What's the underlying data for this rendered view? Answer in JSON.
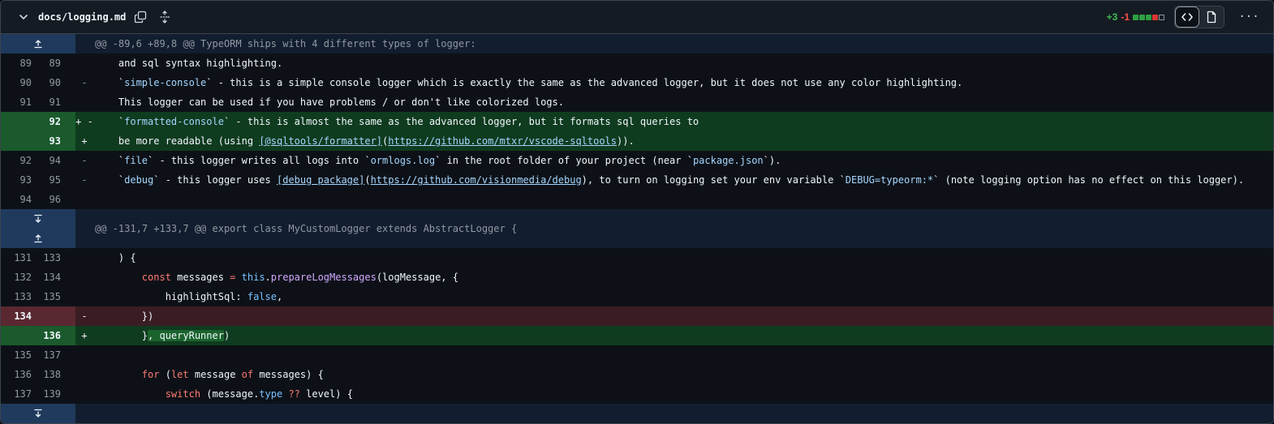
{
  "file": {
    "name": "docs/logging.md",
    "additions": "+3",
    "deletions": "-1",
    "blocks": [
      "g",
      "g",
      "g",
      "r",
      "n"
    ],
    "more": "···"
  },
  "hunks": [
    {
      "header": "@@ -89,6 +89,8 @@ TypeORM ships with 4 different types of logger:",
      "lines": [
        {
          "t": "ctx",
          "o": "89",
          "n": "89",
          "m": "",
          "c": "    and sql syntax highlighting."
        },
        {
          "t": "ctx",
          "o": "90",
          "n": "90",
          "m": "-",
          "c": "    `simple-console` - this is a simple console logger which is exactly the same as the advanced logger, but it does not use any color highlighting."
        },
        {
          "t": "ctx",
          "o": "91",
          "n": "91",
          "m": "",
          "c": "    This logger can be used if you have problems / or don't like colorized logs."
        },
        {
          "t": "add",
          "o": "",
          "n": "92",
          "m": "+ -",
          "c": "    `formatted-console` - this is almost the same as the advanced logger, but it formats sql queries to"
        },
        {
          "t": "add",
          "o": "",
          "n": "93",
          "m": "+",
          "c": "    be more readable (using [@sqltools/formatter](https://github.com/mtxr/vscode-sqltools))."
        },
        {
          "t": "ctx",
          "o": "92",
          "n": "94",
          "m": "-",
          "c": "    `file` - this logger writes all logs into `ormlogs.log` in the root folder of your project (near `package.json`)."
        },
        {
          "t": "ctx",
          "o": "93",
          "n": "95",
          "m": "-",
          "c": "    `debug` - this logger uses [debug package](https://github.com/visionmedia/debug), to turn on logging set your env variable `DEBUG=typeorm:*` (note logging option has no effect on this logger)."
        },
        {
          "t": "ctx",
          "o": "94",
          "n": "96",
          "m": "",
          "c": ""
        }
      ]
    },
    {
      "header": "@@ -131,7 +133,7 @@ export class MyCustomLogger extends AbstractLogger {",
      "lines": [
        {
          "t": "ctx",
          "o": "131",
          "n": "133",
          "m": "",
          "c": "    ) {"
        },
        {
          "t": "ctx",
          "o": "132",
          "n": "134",
          "m": "",
          "c": "        const messages = this.prepareLogMessages(logMessage, {"
        },
        {
          "t": "ctx",
          "o": "133",
          "n": "135",
          "m": "",
          "c": "            highlightSql: false,"
        },
        {
          "t": "del",
          "o": "134",
          "n": "",
          "m": "-",
          "c": "        })"
        },
        {
          "t": "add",
          "o": "",
          "n": "136",
          "m": "+",
          "c": "        }, queryRunner)"
        },
        {
          "t": "ctx",
          "o": "135",
          "n": "137",
          "m": "",
          "c": ""
        },
        {
          "t": "ctx",
          "o": "136",
          "n": "138",
          "m": "",
          "c": "        for (let message of messages) {"
        },
        {
          "t": "ctx",
          "o": "137",
          "n": "139",
          "m": "",
          "c": "            switch (message.type ?? level) {"
        }
      ]
    }
  ]
}
